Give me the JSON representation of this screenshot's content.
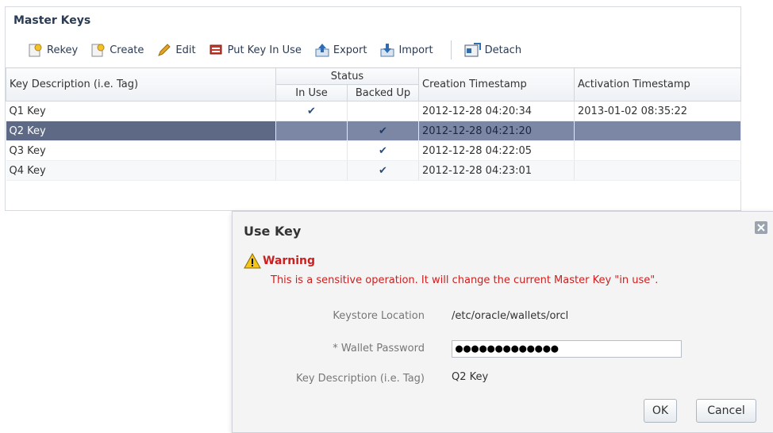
{
  "panel": {
    "title": "Master Keys",
    "toolbar": {
      "rekey": "Rekey",
      "create": "Create",
      "edit": "Edit",
      "put_key_in_use": "Put Key In Use",
      "export": "Export",
      "import": "Import",
      "detach": "Detach"
    },
    "table": {
      "headers": {
        "key_description": "Key Description (i.e. Tag)",
        "status": "Status",
        "in_use": "In Use",
        "backed_up": "Backed Up",
        "creation": "Creation Timestamp",
        "activation": "Activation Timestamp"
      },
      "rows": [
        {
          "name": "Q1 Key",
          "in_use": "✔",
          "backed_up": "",
          "created": "2012-12-28 04:20:34",
          "activated": "2013-01-02 08:35:22"
        },
        {
          "name": "Q2 Key",
          "in_use": "",
          "backed_up": "✔",
          "created": "2012-12-28 04:21:20",
          "activated": ""
        },
        {
          "name": "Q3 Key",
          "in_use": "",
          "backed_up": "✔",
          "created": "2012-12-28 04:22:05",
          "activated": ""
        },
        {
          "name": "Q4 Key",
          "in_use": "",
          "backed_up": "✔",
          "created": "2012-12-28 04:23:01",
          "activated": ""
        }
      ],
      "selected_row": "Q2 Key"
    }
  },
  "dialog": {
    "title": "Use Key",
    "warning_label": "Warning",
    "warning_message": "This is a sensitive operation. It will change the current Master Key \"in use\".",
    "keystore_location_label": "Keystore Location",
    "keystore_location_value": "/etc/oracle/wallets/orcl",
    "wallet_password_label": "* Wallet Password",
    "wallet_password_value": "●●●●●●●●●●●●●",
    "key_description_label": "Key Description (i.e. Tag)",
    "key_description_value": "Q2 Key",
    "ok_label": "OK",
    "cancel_label": "Cancel"
  },
  "colors": {
    "warning_red": "#cc1f1f",
    "selected_row": "#7b87a4",
    "title_navy": "#2a3b53"
  }
}
